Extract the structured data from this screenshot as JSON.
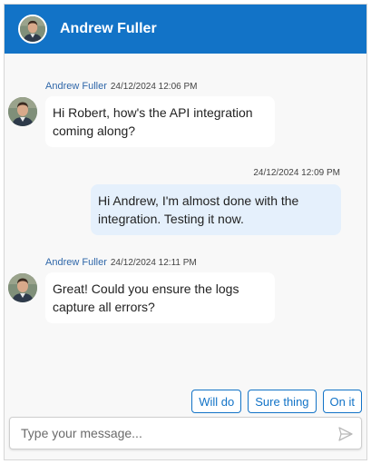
{
  "header": {
    "title": "Andrew Fuller",
    "avatar_icon": "user-avatar-icon"
  },
  "messages": [
    {
      "sender": "Andrew Fuller",
      "time": "24/12/2024 12:06 PM",
      "text": "Hi Robert, how's the API integration coming along?",
      "direction": "incoming"
    },
    {
      "sender": "",
      "time": "24/12/2024 12:09 PM",
      "text": "Hi Andrew, I'm almost done with the integration. Testing it now.",
      "direction": "outgoing"
    },
    {
      "sender": "Andrew Fuller",
      "time": "24/12/2024 12:11 PM",
      "text": "Great! Could you ensure the logs capture all errors?",
      "direction": "incoming"
    }
  ],
  "suggestions": [
    "Will do",
    "Sure thing",
    "On it"
  ],
  "composer": {
    "placeholder": "Type your message...",
    "send_icon": "send-icon"
  },
  "colors": {
    "accent": "#1273c7",
    "sender_name": "#2f67a9",
    "incoming_bubble": "#ffffff",
    "outgoing_bubble": "#e5f0fc",
    "background": "#f8f8f8"
  }
}
